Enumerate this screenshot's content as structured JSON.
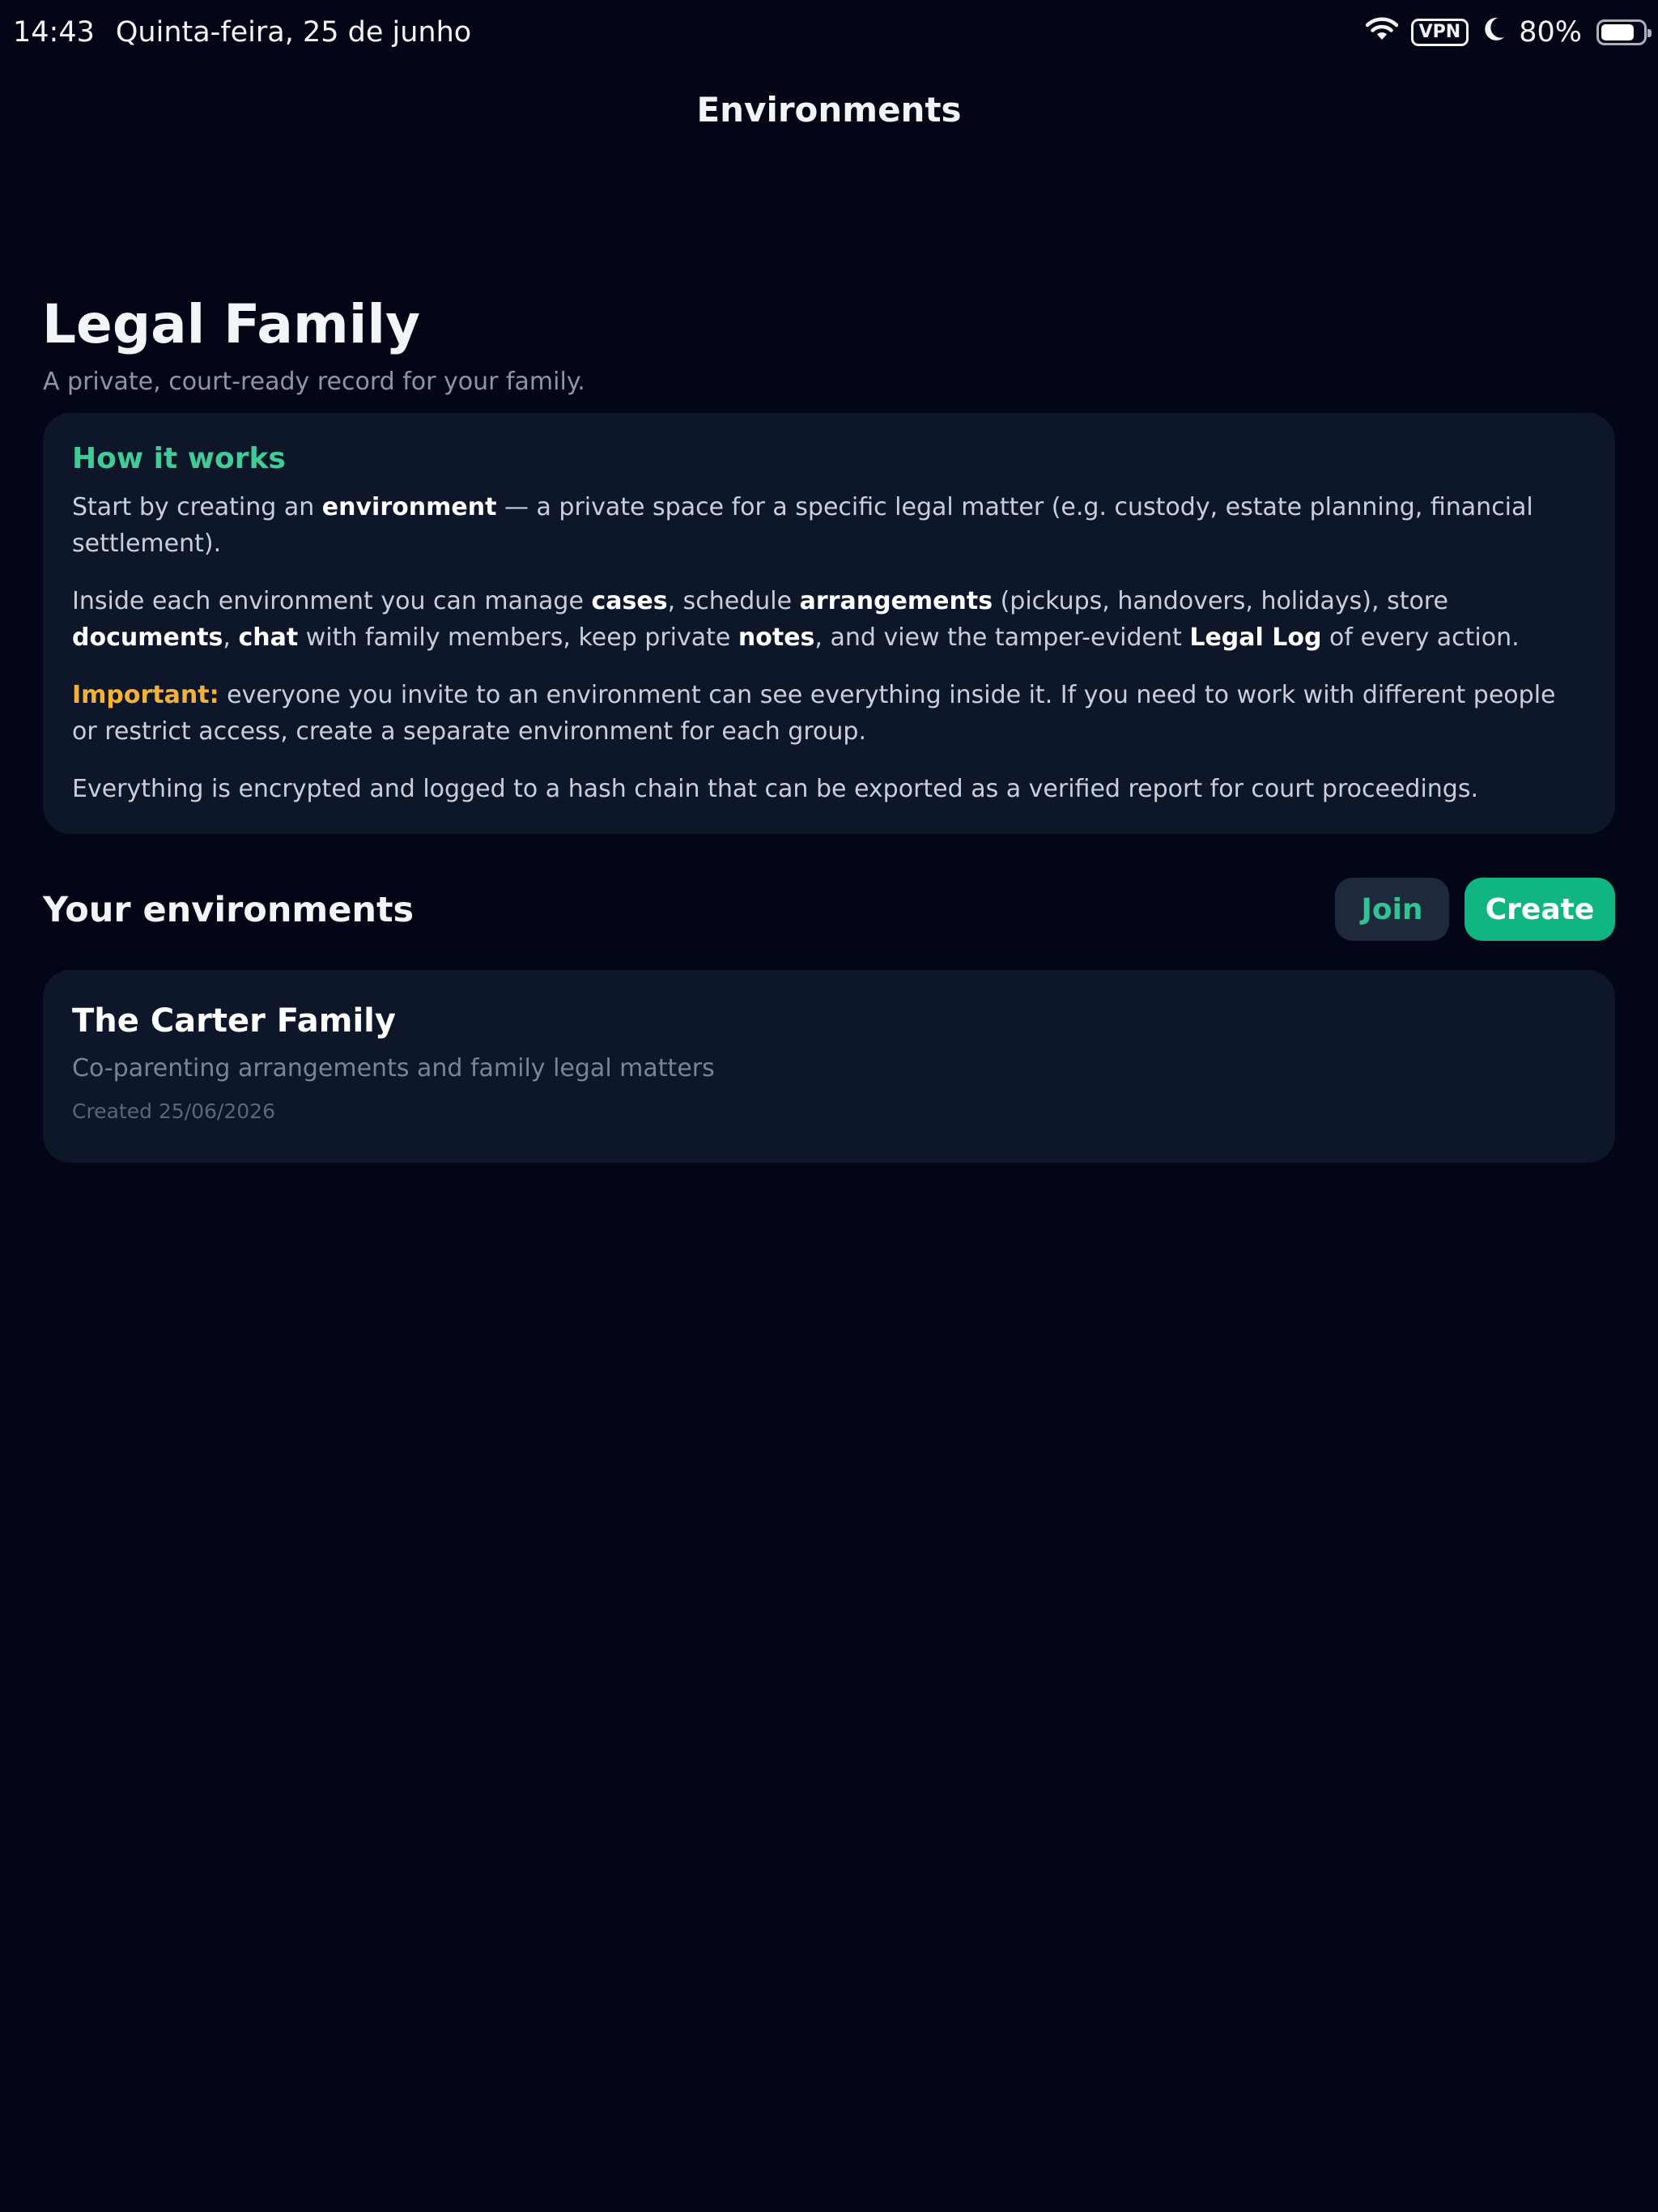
{
  "status_bar": {
    "time": "14:43",
    "date": "Quinta-feira, 25 de junho",
    "vpn": "VPN",
    "battery_percent": "80%",
    "battery_level": 0.8,
    "icons": [
      "wifi-icon",
      "moon-icon",
      "battery-icon"
    ]
  },
  "nav": {
    "title": "Environments"
  },
  "header": {
    "title": "Legal Family",
    "subtitle": "A private, court-ready record for your family."
  },
  "how_it_works": {
    "title": "How it works",
    "p1": {
      "t1": "Start by creating an ",
      "b1": "environment",
      "t2": " — a private space for a specific legal matter (e.g. custody, estate planning, financial settlement)."
    },
    "p2": {
      "t1": "Inside each environment you can manage ",
      "b1": "cases",
      "t2": ", schedule ",
      "b2": "arrangements",
      "t3": " (pickups, handovers, holidays), store ",
      "b3": "documents",
      "t4": ", ",
      "b4": "chat",
      "t5": " with family members, keep private ",
      "b5": "notes",
      "t6": ", and view the tamper-evident ",
      "b6": "Legal Log",
      "t7": " of every action."
    },
    "p3": {
      "label": "Important:",
      "text": " everyone you invite to an environment can see everything inside it. If you need to work with different people or restrict access, create a separate environment for each group."
    },
    "p4": "Everything is encrypted and logged to a hash chain that can be exported as a verified report for court proceedings."
  },
  "environments": {
    "title": "Your environments",
    "join_label": "Join",
    "create_label": "Create",
    "items": [
      {
        "name": "The Carter Family",
        "description": "Co-parenting arrangements and family legal matters",
        "created": "Created 25/06/2026"
      }
    ]
  },
  "colors": {
    "background": "#030617",
    "card": "#0e172a",
    "accent": "#10b582",
    "accent_text": "#3fcc97",
    "warning": "#f2b23a"
  }
}
